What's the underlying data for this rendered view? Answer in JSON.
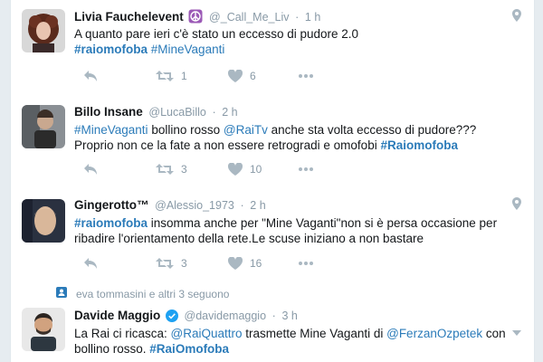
{
  "tweets": [
    {
      "name": "Livia Fauchelevent",
      "handle": "@_Call_Me_Liv",
      "time": "1 h",
      "segments": [
        {
          "t": "A quanto pare ieri c'è stato un eccesso di pudore 2.0",
          "k": "text"
        },
        {
          "t": "\n",
          "k": "br"
        },
        {
          "t": "#raiomofoba",
          "k": "tag"
        },
        {
          "t": " ",
          "k": "text"
        },
        {
          "t": "#MineVaganti",
          "k": "link"
        }
      ],
      "retweets": "1",
      "likes": "6"
    },
    {
      "name": "Billo Insane",
      "handle": "@LucaBillo",
      "time": "2 h",
      "segments": [
        {
          "t": "#MineVaganti",
          "k": "link"
        },
        {
          "t": " bollino rosso ",
          "k": "text"
        },
        {
          "t": "@RaiTv",
          "k": "link"
        },
        {
          "t": " anche sta volta eccesso di pudore???",
          "k": "text"
        },
        {
          "t": "\n",
          "k": "br"
        },
        {
          "t": "Proprio non ce la fate a non essere retrogradi e omofobi ",
          "k": "text"
        },
        {
          "t": "#Raiomofoba",
          "k": "tag"
        }
      ],
      "retweets": "3",
      "likes": "10"
    },
    {
      "name": "Gingerotto™",
      "handle": "@Alessio_1973",
      "time": "2 h",
      "segments": [
        {
          "t": "#raiomofoba",
          "k": "tag"
        },
        {
          "t": " insomma anche per \"Mine Vaganti\"non si è persa occasione per",
          "k": "text"
        },
        {
          "t": "\n",
          "k": "br"
        },
        {
          "t": "ribadire l'orientamento della rete.Le scuse iniziano a non bastare",
          "k": "text"
        }
      ],
      "retweets": "3",
      "likes": "16"
    },
    {
      "context": "eva tommasini e altri 3 seguono",
      "name": "Davide Maggio",
      "handle": "@davidemaggio",
      "time": "3 h",
      "segments": [
        {
          "t": "La Rai ci ricasca: ",
          "k": "text"
        },
        {
          "t": "@RaiQuattro",
          "k": "link"
        },
        {
          "t": " trasmette Mine Vaganti di ",
          "k": "text"
        },
        {
          "t": "@FerzanOzpetek",
          "k": "link"
        },
        {
          "t": " con",
          "k": "text"
        },
        {
          "t": "\n",
          "k": "br"
        },
        {
          "t": "bollino rosso. ",
          "k": "text"
        },
        {
          "t": "#RaiOmofoba",
          "k": "tag"
        }
      ]
    }
  ],
  "colors": {
    "link": "#2b7bb9",
    "muted": "#8899a6",
    "icon": "#aab8c2",
    "verified": "#1da1f2",
    "peace_badge": "#9b59b6",
    "border": "#e1e8ed"
  },
  "icons": [
    "reply-icon",
    "retweet-icon",
    "like-icon",
    "more-icon",
    "location-pin-icon",
    "peace-badge-icon",
    "verified-badge-icon",
    "follow-context-icon",
    "caret-down-icon"
  ]
}
